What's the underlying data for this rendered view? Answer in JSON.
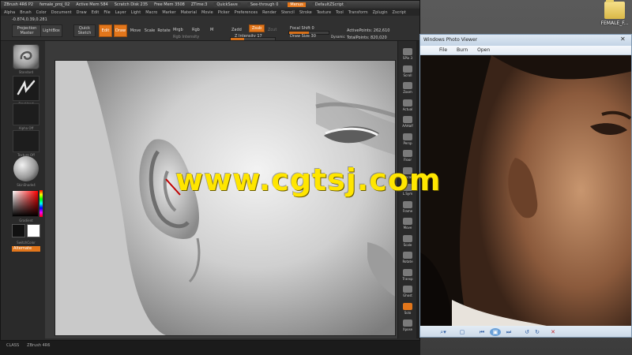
{
  "zbrush": {
    "title_items": [
      "ZBrush 4R6 P2",
      "female_proj_02",
      "Active Mem 584",
      "Scratch Disk 235",
      "Free Mem 3508",
      "ZTime:3"
    ],
    "quicksave": "QuickSave",
    "see_through": "See-through",
    "see_through_value": "0",
    "menus_label": "Menus",
    "default_zscript": "DefaultZScript",
    "menu_items": [
      "Alpha",
      "Brush",
      "Color",
      "Document",
      "Draw",
      "Edit",
      "File",
      "Layer",
      "Light",
      "Macro",
      "Marker",
      "Material",
      "Movie",
      "Picker",
      "Preferences",
      "Render",
      "Stencil",
      "Stroke",
      "Texture",
      "Tool",
      "Transform",
      "Zplugin",
      "Zscript"
    ],
    "coords": "-0.874,0.39,0.281",
    "projection_master": "Projection Master",
    "lightbox": "LightBox",
    "quick_sketch": "Quick Sketch",
    "edit": "Edit",
    "draw": "Draw",
    "move": "Move",
    "scale": "Scale",
    "rotate": "Rotate",
    "mrgb": "Mrgb",
    "rgb": "Rgb",
    "m": "M",
    "zadd": "Zadd",
    "zsub": "Zsub",
    "zcut": "Zcut",
    "rgb_intensity": "Rgb Intensity",
    "z_intensity_label": "Z Intensity",
    "z_intensity_value": "17",
    "focal_shift_label": "Focal Shift",
    "focal_shift_value": "0",
    "draw_size_label": "Draw Size",
    "draw_size_value": "30",
    "dynamic": "Dynamic",
    "active_points": "ActivePoints: 262,610",
    "total_points": "TotalPoints: 820,020",
    "left": {
      "standard": "Standard",
      "freehand": "FreeHand",
      "alpha_off": "Alpha Off",
      "texture_off": "Texture Off",
      "skin_shade": "SkinShade4",
      "gradient": "Gradient",
      "switch_color": "SwitchColor",
      "alternate": "Alternate"
    },
    "right_tools": [
      "SPix 3",
      "Scroll",
      "Zoom",
      "Actual",
      "AAHalf",
      "Persp",
      "Floor",
      "Local",
      "L.Sym",
      "Frame",
      "Move",
      "Scale",
      "Rotate",
      "Transp",
      "Ghost",
      "Solo",
      "Xpose"
    ],
    "status": [
      "CLASS",
      "ZBrush 4R6"
    ]
  },
  "photo_viewer": {
    "title": "Windows Photo Viewer",
    "menu": [
      "File",
      "Burn",
      "Open"
    ],
    "close": "✕"
  },
  "desktop": {
    "icon_label": "FEMALE_F..."
  },
  "watermark": "www.cgtsj.com",
  "colors": {
    "zbrush_accent": "#e2761b",
    "watermark": "#ffe600"
  }
}
